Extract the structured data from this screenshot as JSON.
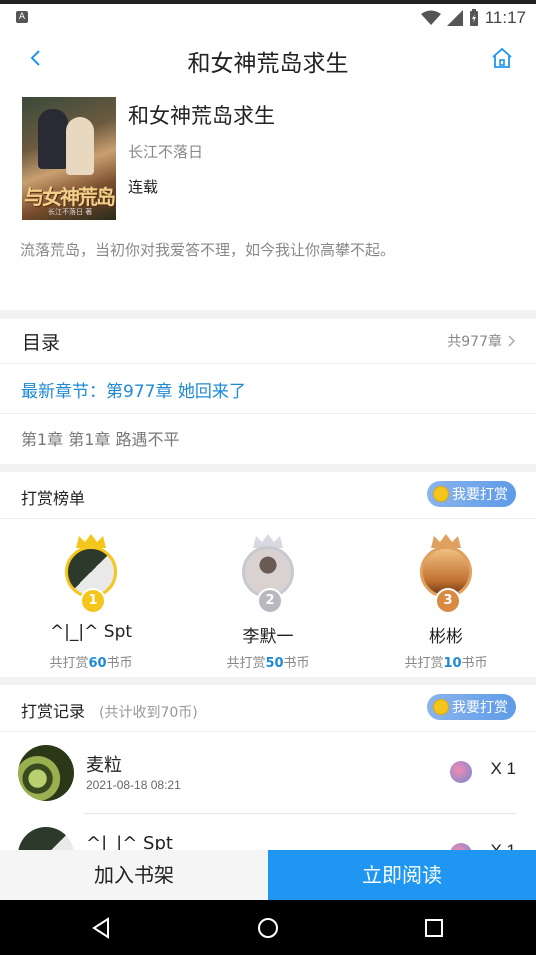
{
  "status_bar": {
    "time": "11:17",
    "app_badge": "A"
  },
  "header": {
    "title": "和女神荒岛求生"
  },
  "book": {
    "name": "和女神荒岛求生",
    "author": "长江不落日",
    "status": "连载",
    "description": "流落荒岛，当初你对我爱答不理，如今我让你高攀不起。",
    "cover_title": "与女神荒岛",
    "cover_author": "长江不落日 著"
  },
  "catalog": {
    "title": "目录",
    "total": "共977章",
    "latest": "最新章节：第977章 她回来了",
    "first": "第1章  第1章 路遇不平"
  },
  "ranking": {
    "title": "打赏榜单",
    "tip_button": "我要打赏",
    "entries": [
      {
        "rank": "1",
        "name": "^|_|^ Spt",
        "prefix": "共打赏",
        "amount": "60",
        "suffix": "书币"
      },
      {
        "rank": "2",
        "name": "李默一",
        "prefix": "共打赏",
        "amount": "50",
        "suffix": "书币"
      },
      {
        "rank": "3",
        "name": "彬彬",
        "prefix": "共打赏",
        "amount": "10",
        "suffix": "书币"
      }
    ]
  },
  "records": {
    "title": "打赏记录",
    "subtitle": "(共计收到70币)",
    "tip_button": "我要打赏",
    "items": [
      {
        "name": "麦粒",
        "date": "2021-08-18 08:21",
        "count": "X 1"
      },
      {
        "name": "^|_|^ Spt",
        "date": "",
        "count": "X 1"
      }
    ]
  },
  "bottom": {
    "add_shelf": "加入书架",
    "read_now": "立即阅读"
  },
  "colors": {
    "accent": "#1e96f2",
    "link": "#1e8ad6",
    "gold": "#f4c51a",
    "silver": "#c8c8d0",
    "bronze": "#e0a060"
  }
}
